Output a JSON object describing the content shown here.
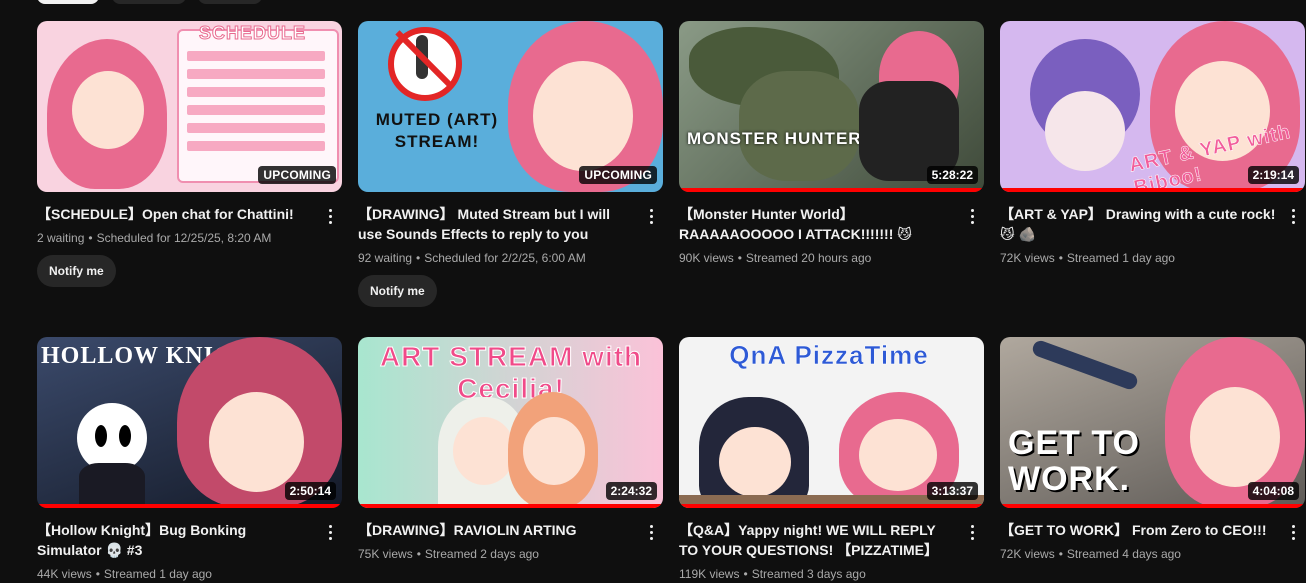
{
  "videos": [
    {
      "title": "【SCHEDULE】Open chat for Chattini!",
      "views": "2 waiting",
      "time": "Scheduled for 12/25/25, 8:20 AM",
      "badge": "UPCOMING",
      "notify": "Notify me",
      "thumb_text": "SCHEDULE",
      "thumb_color": "#f7b9cf"
    },
    {
      "title": "【DRAWING】 Muted Stream but I will use Sounds Effects to reply to you",
      "views": "92 waiting",
      "time": "Scheduled for 2/2/25, 6:00 AM",
      "badge": "UPCOMING",
      "notify": "Notify me",
      "thumb_text": "MUTED (ART) STREAM!",
      "thumb_color": "#57a9d6"
    },
    {
      "title": "【Monster Hunter World】RAAAAAOOOOO I ATTACK!!!!!!! 😼",
      "views": "90K views",
      "time": "Streamed 20 hours ago",
      "badge": "5:28:22",
      "thumb_text": "MONSTER HUNTER",
      "thumb_color": "#6c7d5e"
    },
    {
      "title": "【ART & YAP】 Drawing with a cute rock! 😼 🪨",
      "views": "72K views",
      "time": "Streamed 1 day ago",
      "badge": "2:19:14",
      "thumb_text": "ART & YAP with Biboo!",
      "thumb_color": "#c9a6e8"
    },
    {
      "title": "【Hollow Knight】Bug Bonking Simulator 💀 #3",
      "views": "44K views",
      "time": "Streamed 1 day ago",
      "badge": "2:50:14",
      "thumb_text": "HOLLOW KNIGHT",
      "thumb_color": "#2a3550"
    },
    {
      "title": "【DRAWING】RAVIOLIN ARTING",
      "views": "75K views",
      "time": "Streamed 2 days ago",
      "badge": "2:24:32",
      "thumb_text": "ART STREAM with Cecilia!",
      "thumb_color": "#9fe0c4"
    },
    {
      "title": "【Q&A】Yappy night! WE WILL REPLY TO YOUR QUESTIONS! 【PIZZATIME】",
      "views": "119K views",
      "time": "Streamed 3 days ago",
      "badge": "3:13:37",
      "thumb_text": "QnA PizzaTime",
      "thumb_color": "#f4f4f4"
    },
    {
      "title": "【GET TO WORK】 From Zero to CEO!!!",
      "views": "72K views",
      "time": "Streamed 4 days ago",
      "badge": "4:04:08",
      "thumb_text": "GET TO WORK.",
      "thumb_color": "#8a8580"
    }
  ]
}
